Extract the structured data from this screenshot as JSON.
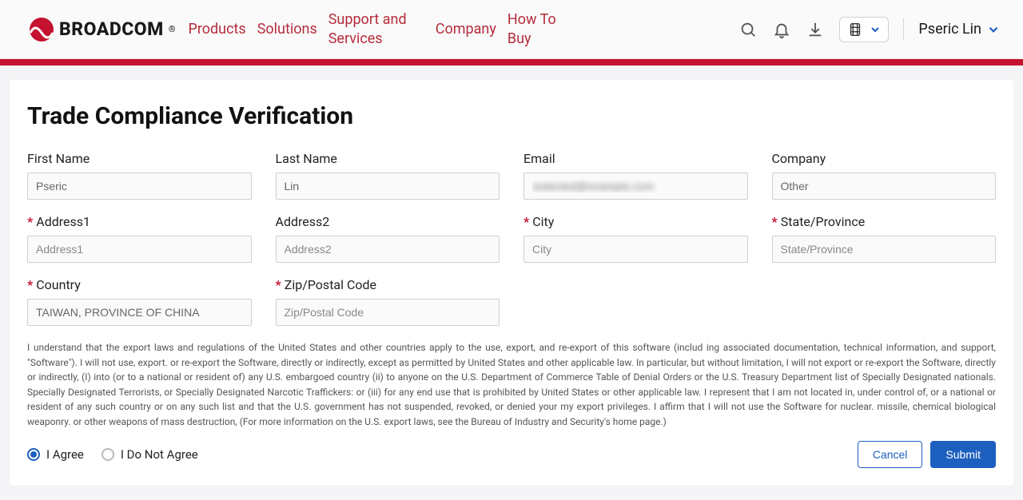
{
  "header": {
    "brand": "BROADCOM",
    "nav": {
      "products": "Products",
      "solutions": "Solutions",
      "support": "Support and Services",
      "company": "Company",
      "how_to_buy": "How To Buy"
    },
    "user_name": "Pseric Lin"
  },
  "page": {
    "title": "Trade Compliance Verification"
  },
  "form": {
    "labels": {
      "first_name": "First Name",
      "last_name": "Last Name",
      "email": "Email",
      "company": "Company",
      "address1": "Address1",
      "address2": "Address2",
      "city": "City",
      "state": "State/Province",
      "country": "Country",
      "zip": "Zip/Postal Code"
    },
    "values": {
      "first_name": "Pseric",
      "last_name": "Lin",
      "email": "redacted@example.com",
      "company": "Other",
      "country": "TAIWAN, PROVINCE OF CHINA"
    },
    "placeholders": {
      "address1": "Address1",
      "address2": "Address2",
      "city": "City",
      "state": "State/Province",
      "zip": "Zip/Postal Code"
    }
  },
  "legal_text": "I understand that the export laws and regulations of the United States and other countries apply to the use, export, and re-export of this software (includ ing associated documentation, technical information, and support, \"Software\"). I will not use, export. or re-export the Software, directly or indirectly, except as permitted by United States and other applicable law. In particular, but without limitation, I will not export or re-export the Software, directly or indirectly, (I) into (or to a national or resident of) any U.S. embargoed country (ii) to anyone on the U.S. Department of Commerce Table of Denial Orders or the U.S. Treasury Department list of Specially Designated nationals. Specially Designated Terrorists, or Specially Designated Narcotic Traffickers: or (iii) for any end use that is prohibited by United States or other applicable law. I represent that I am not located in, under control of, or a national or resident of any such country or on any such list and that the U.S. government has not suspended, revoked, or denied your my export privileges. I affirm that I will not use the Software for nuclear. missile, chemical biological weaponry. or other weapons of mass destruction, (For more information on the U.S. export laws, see the Bureau of Industry and Security's home page.)",
  "radios": {
    "agree": "I Agree",
    "disagree": "I Do Not Agree"
  },
  "actions": {
    "cancel": "Cancel",
    "submit": "Submit"
  }
}
